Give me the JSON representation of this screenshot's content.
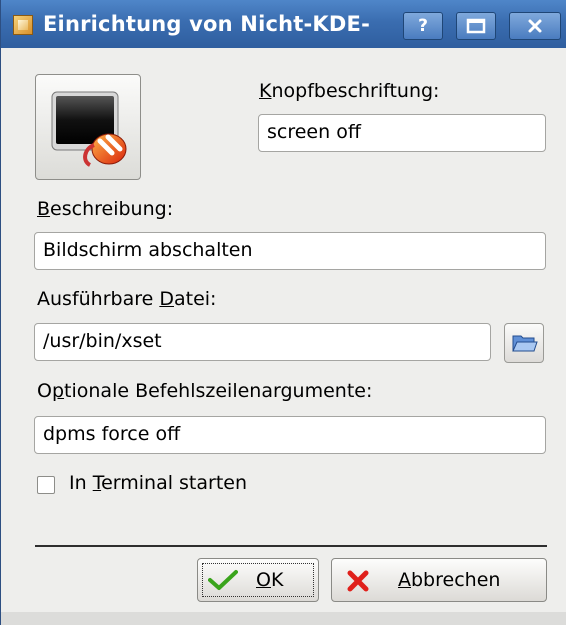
{
  "window": {
    "title": "Einrichtung von Nicht-KDE-",
    "help_button": "?",
    "maximize_button": "□",
    "close_button": "×"
  },
  "form": {
    "button_label_label_u": "K",
    "button_label_label_rest": "nopfbeschriftung:",
    "button_label_value": "screen off",
    "description_label_u": "B",
    "description_label_rest": "eschreibung:",
    "description_value": "Bildschirm abschalten",
    "executable_label_pre": "Ausführbare ",
    "executable_label_u": "D",
    "executable_label_rest": "atei:",
    "executable_value": "/usr/bin/xset",
    "args_label_pre": "O",
    "args_label_u": "p",
    "args_label_rest": "tionale Befehlszeilenargumente:",
    "args_value": "dpms force off",
    "terminal_label_pre": "In ",
    "terminal_label_u": "T",
    "terminal_label_rest": "erminal starten",
    "terminal_checked": false
  },
  "buttons": {
    "ok_u": "O",
    "ok_rest": "K",
    "cancel_u": "A",
    "cancel_rest": "bbrechen"
  },
  "icons": {
    "window_icon": "kde-app-icon",
    "preview_icon": "monitor-power-plug-icon",
    "browse_icon": "open-folder-icon",
    "ok_icon": "green-check-icon",
    "cancel_icon": "red-x-icon"
  },
  "colors": {
    "titlebar": "#3a6db0",
    "window_bg": "#eeeeec"
  }
}
